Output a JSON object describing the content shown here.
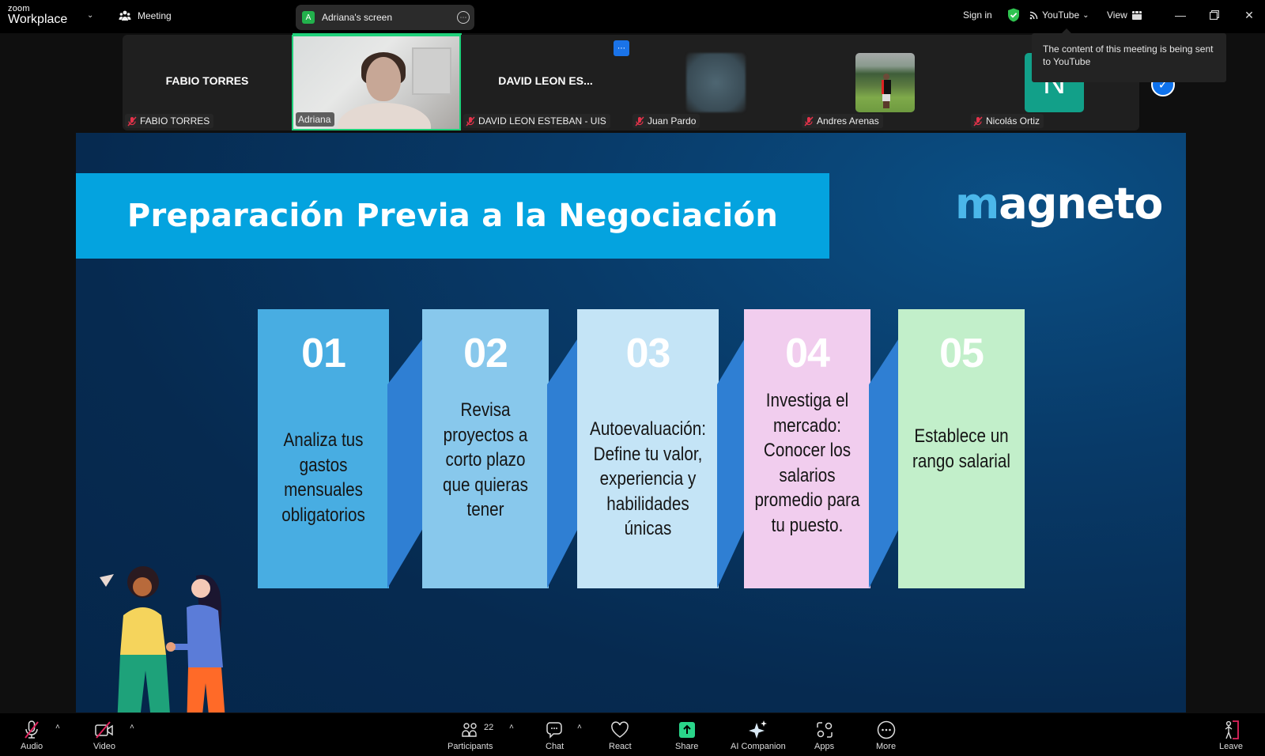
{
  "titlebar": {
    "brand_small": "zoom",
    "brand_large": "Workplace",
    "meeting_label": "Meeting",
    "screen_share": {
      "badge": "A",
      "label": "Adriana's screen"
    },
    "sign_in": "Sign in",
    "stream_label": "YouTube",
    "view_label": "View"
  },
  "tooltip": {
    "text": "The content of this meeting is being sent to YouTube"
  },
  "participants": [
    {
      "display": "FABIO TORRES",
      "name": "FABIO TORRES",
      "muted": true,
      "type": "name"
    },
    {
      "name": "Adriana",
      "muted": false,
      "type": "video",
      "active_speaker": true
    },
    {
      "display": "DAVID LEON ES...",
      "name": "DAVID LEON ESTEBAN - UIS",
      "muted": true,
      "type": "name"
    },
    {
      "name": "Juan Pardo",
      "muted": true,
      "type": "avatar-blur"
    },
    {
      "name": "Andres Arenas",
      "muted": true,
      "type": "avatar-photo"
    },
    {
      "name": "Nicolás Ortiz",
      "muted": true,
      "type": "avatar-letter",
      "initial": "N"
    }
  ],
  "slide": {
    "title": "Preparación Previa a la Negociación",
    "brand": {
      "first": "m",
      "rest": "agneto"
    },
    "steps": [
      {
        "num": "01",
        "text": "Analiza tus gastos mensuales obligatorios",
        "color": "#48ade2"
      },
      {
        "num": "02",
        "text": "Revisa proyectos a corto plazo que quieras tener",
        "color": "#88c8ec"
      },
      {
        "num": "03",
        "text": "Autoevaluación: Define tu valor, experiencia y habilidades únicas",
        "color": "#c4e4f6"
      },
      {
        "num": "04",
        "text": "Investiga el mercado: Conocer los salarios promedio para tu puesto.",
        "color": "#f1cdee"
      },
      {
        "num": "05",
        "text": "Establece un rango salarial",
        "color": "#c2efca"
      }
    ]
  },
  "toolbar": {
    "audio": "Audio",
    "video": "Video",
    "participants": "Participants",
    "participants_count": "22",
    "chat": "Chat",
    "react": "React",
    "share": "Share",
    "ai_companion": "AI Companion",
    "apps": "Apps",
    "more": "More",
    "leave": "Leave"
  },
  "colors": {
    "share_green": "#2ad58a",
    "speaker_border": "#1ed07a",
    "leave_red": "#e0245e",
    "title_band": "#04a3df"
  }
}
